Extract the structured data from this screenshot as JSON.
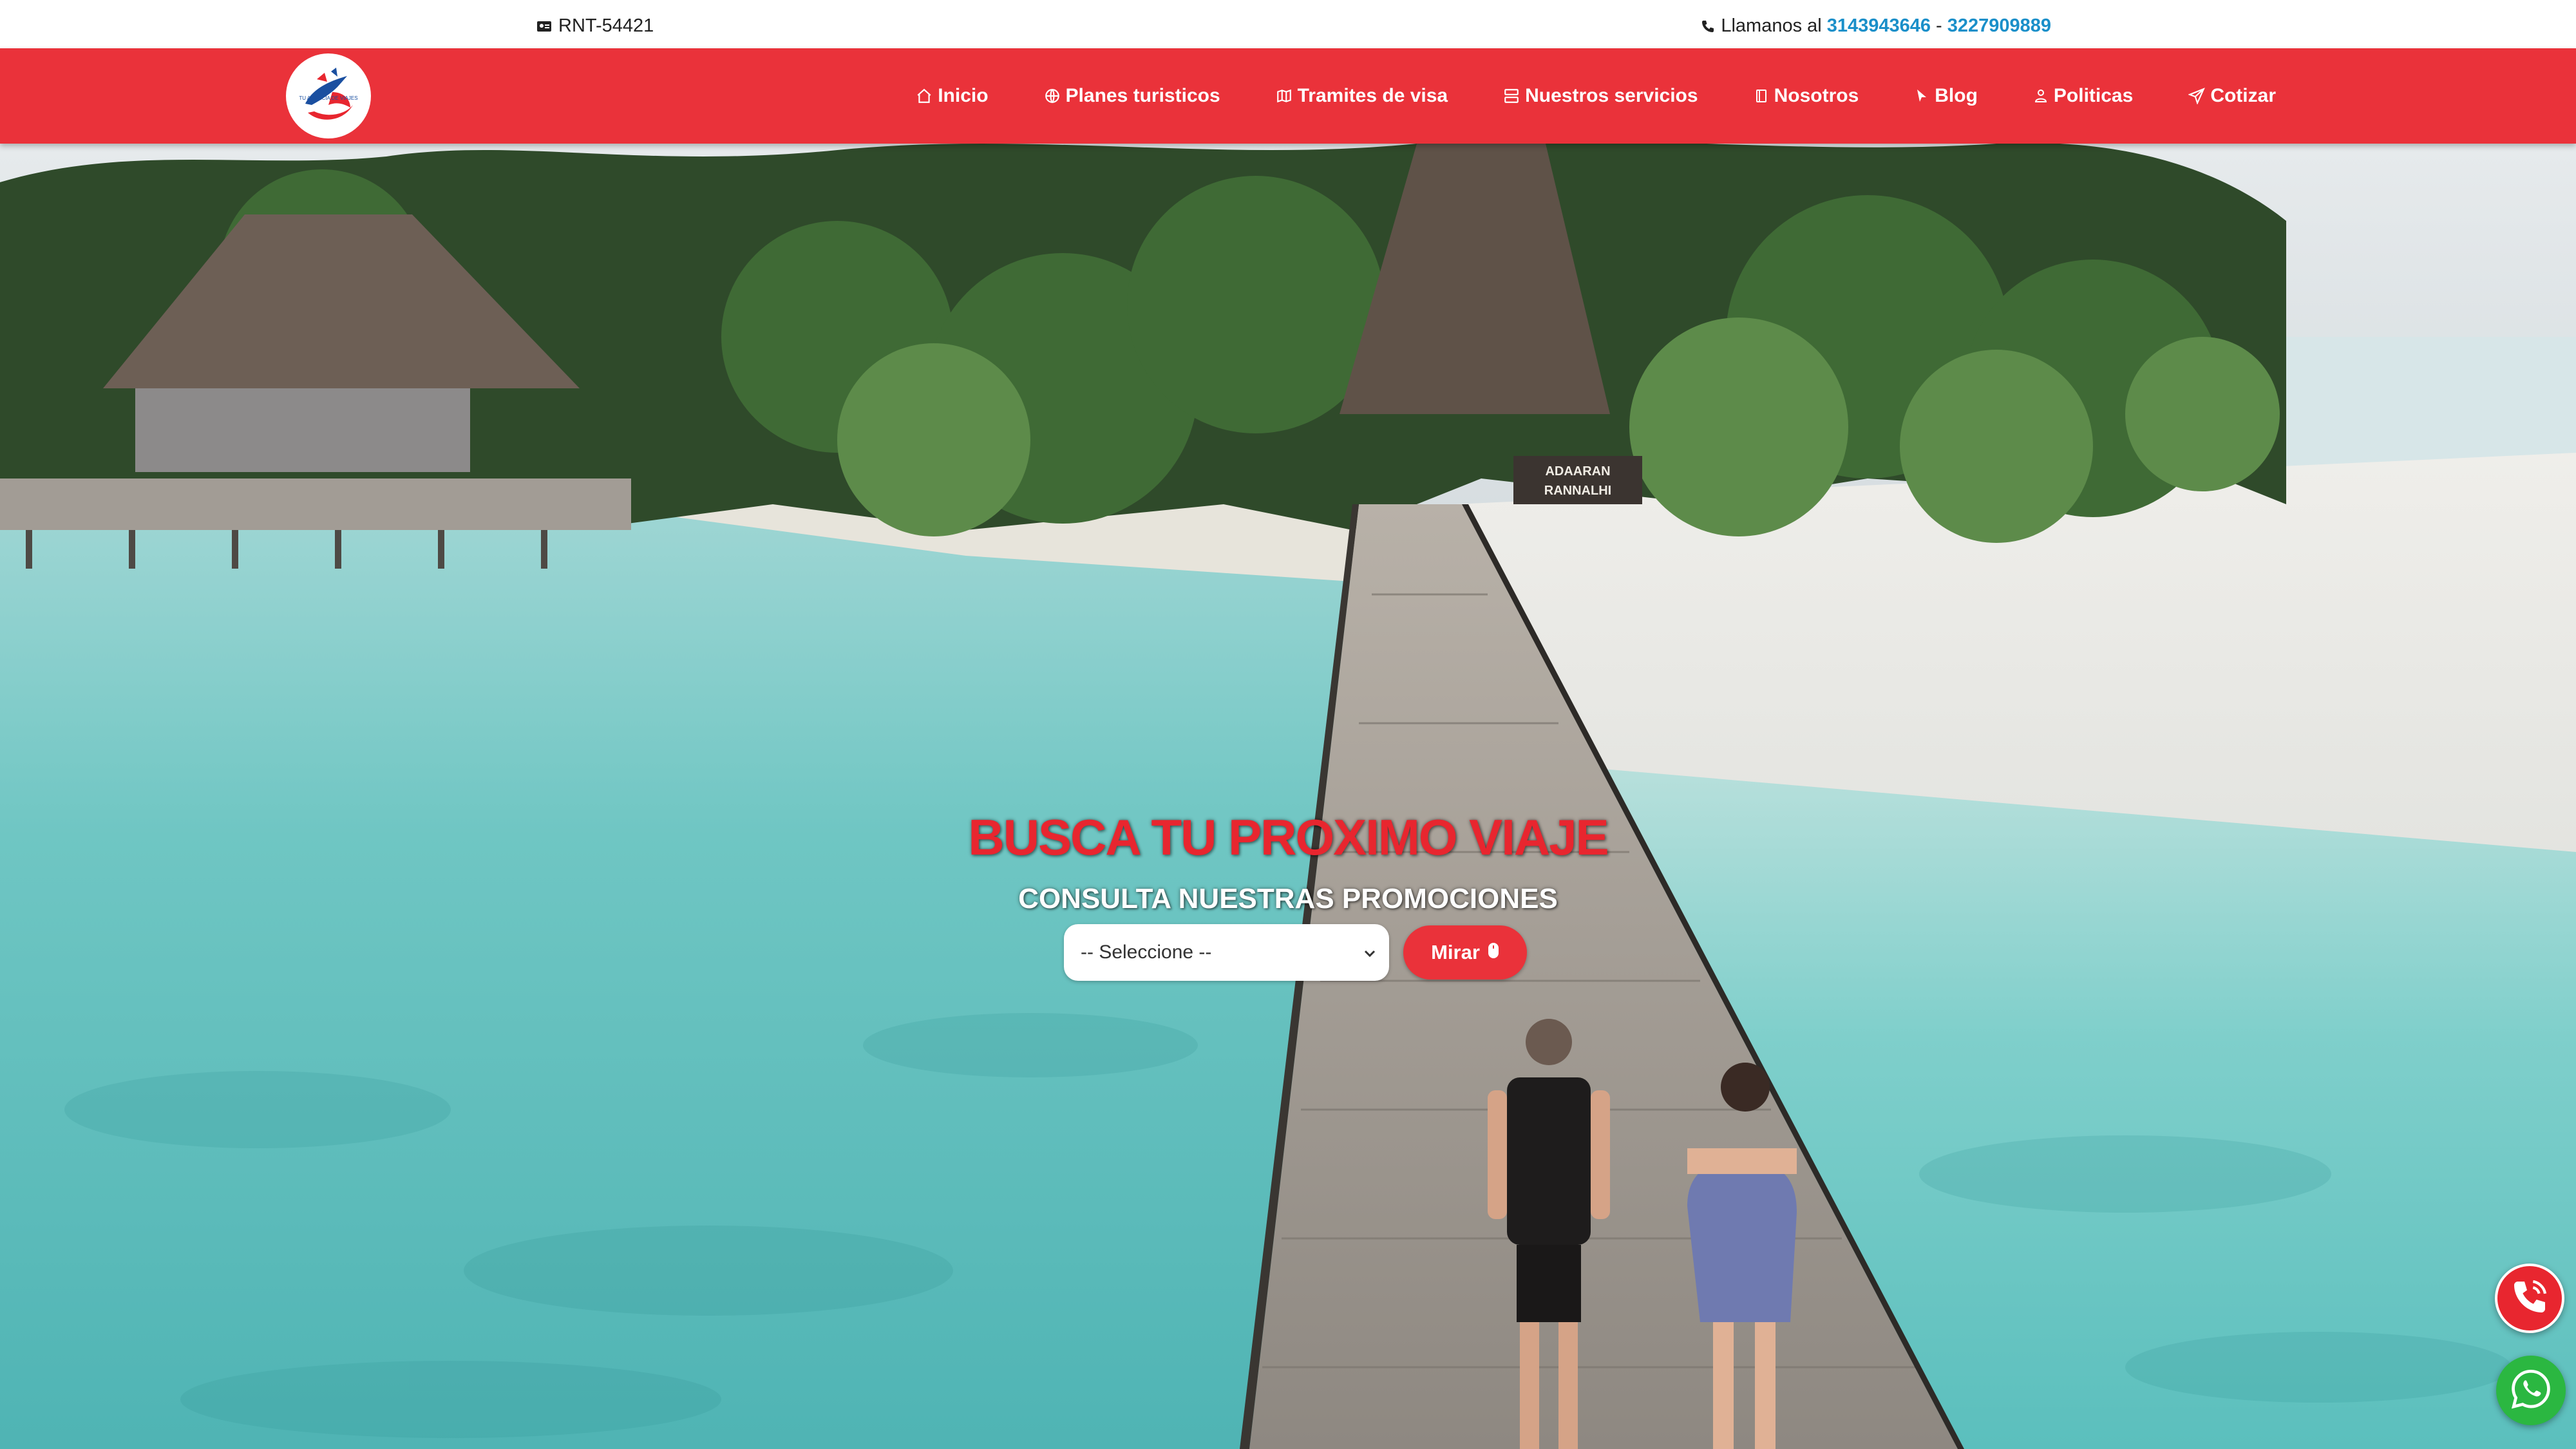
{
  "topbar": {
    "rnt_icon": "id-card-icon",
    "rnt": "RNT-54421",
    "phone_icon": "phone-icon",
    "call_label": "Llamanos al",
    "phone_1": "3143943646",
    "separator": "-",
    "phone_2": "3227909889"
  },
  "nav": {
    "logo_text": "TU AGENCIA DE VIAJES",
    "items": [
      {
        "label": "Inicio",
        "icon": "home-icon"
      },
      {
        "label": "Planes turisticos",
        "icon": "globe-icon"
      },
      {
        "label": "Tramites de visa",
        "icon": "map-icon"
      },
      {
        "label": "Nuestros servicios",
        "icon": "server-icon"
      },
      {
        "label": "Nosotros",
        "icon": "book-icon"
      },
      {
        "label": "Blog",
        "icon": "cursor-icon"
      },
      {
        "label": "Politicas",
        "icon": "user-icon"
      },
      {
        "label": "Cotizar",
        "icon": "send-icon"
      }
    ]
  },
  "hero": {
    "title": "BUSCA TU PROXIMO VIAJE",
    "subtitle": "CONSULTA NUESTRAS PROMOCIONES",
    "select_value": "-- Seleccione --",
    "button_label": "Mirar",
    "button_icon": "mouse-icon",
    "sign_line1": "ADAARAN",
    "sign_line2": "RANNALHI"
  },
  "floating": {
    "call_icon": "phone-call-icon",
    "whatsapp_icon": "whatsapp-icon"
  },
  "colors": {
    "brand_red": "#ea323a",
    "link_blue": "#1a8fc9",
    "whatsapp_green": "#2bb741"
  }
}
